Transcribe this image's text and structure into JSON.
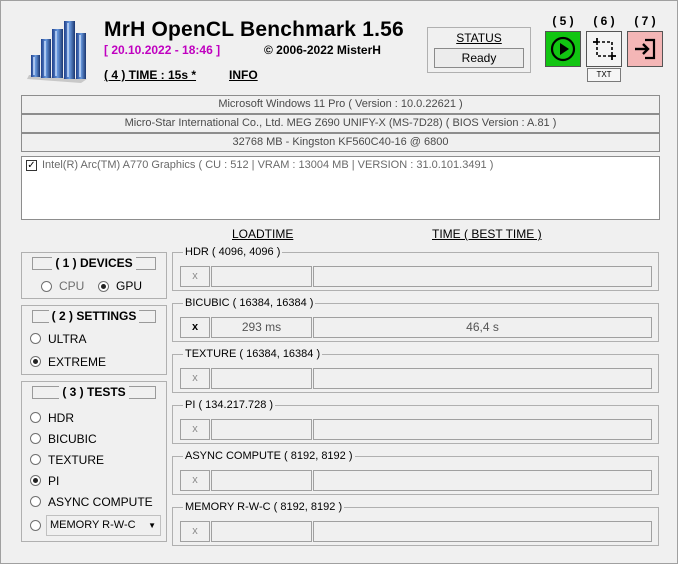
{
  "header": {
    "title": "MrH OpenCL Benchmark 1.56",
    "date": "[ 20.10.2022 - 18:46 ]",
    "copyright": "©  2006-2022 MisterH",
    "time_link": "( 4 ) TIME : 15s *",
    "info_link": "INFO"
  },
  "status": {
    "title": "STATUS",
    "value": "Ready"
  },
  "toolbar": {
    "run_number": "( 5 )",
    "screenshot_number": "( 6 )",
    "exit_number": "( 7 )",
    "txt_label": "TXT",
    "run_color": "#12c512",
    "exit_color": "#f4b6b6"
  },
  "system": {
    "os": "Microsoft Windows 11 Pro ( Version : 10.0.22621 )",
    "board": "Micro-Star International Co., Ltd. MEG Z690 UNIFY-X (MS-7D28) ( BIOS Version : A.81 )",
    "memory": "32768 MB - Kingston KF560C40-16         @ 6800"
  },
  "device_list": {
    "items": [
      {
        "label": "Intel(R) Arc(TM) A770 Graphics ( CU : 512 | VRAM : 13004 MB | VERSION : 31.0.101.3491 )",
        "checked": true
      }
    ]
  },
  "columns": {
    "loadtime": "LOADTIME",
    "time": "TIME ( BEST TIME )"
  },
  "devices": {
    "title": "( 1 ) DEVICES",
    "options": [
      {
        "label": "CPU",
        "selected": false
      },
      {
        "label": "GPU",
        "selected": true
      }
    ]
  },
  "settings": {
    "title": "( 2 ) SETTINGS",
    "options": [
      {
        "label": "ULTRA",
        "selected": false
      },
      {
        "label": "EXTREME",
        "selected": true
      }
    ]
  },
  "tests": {
    "title": "( 3 ) TESTS",
    "options": [
      {
        "label": "HDR",
        "selected": false
      },
      {
        "label": "BICUBIC",
        "selected": false
      },
      {
        "label": "TEXTURE",
        "selected": false
      },
      {
        "label": "PI",
        "selected": true
      },
      {
        "label": "ASYNC COMPUTE",
        "selected": false
      }
    ],
    "dropdown_value": "MEMORY R-W-C"
  },
  "results": [
    {
      "label": "HDR ( 4096, 4096 )",
      "x": "x",
      "loadtime": "",
      "time": "",
      "active": false
    },
    {
      "label": "BICUBIC ( 16384, 16384 )",
      "x": "x",
      "loadtime": "293 ms",
      "time": "46,4 s",
      "active": true
    },
    {
      "label": "TEXTURE ( 16384, 16384 )",
      "x": "x",
      "loadtime": "",
      "time": "",
      "active": false
    },
    {
      "label": "PI ( 134.217.728 )",
      "x": "x",
      "loadtime": "",
      "time": "",
      "active": false
    },
    {
      "label": "ASYNC COMPUTE ( 8192, 8192 )",
      "x": "x",
      "loadtime": "",
      "time": "",
      "active": false
    },
    {
      "label": "MEMORY R-W-C ( 8192, 8192 )",
      "x": "x",
      "loadtime": "",
      "time": "",
      "active": false
    }
  ]
}
